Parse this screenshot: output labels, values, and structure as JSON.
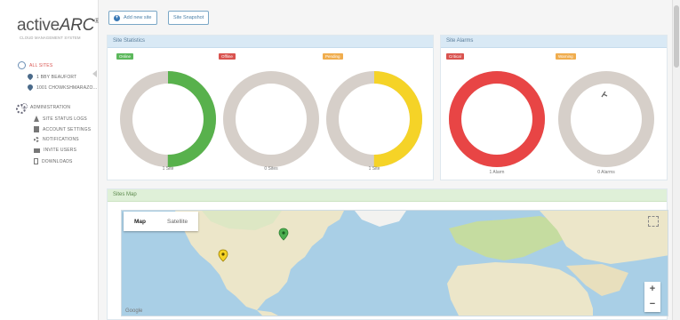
{
  "logo": {
    "text_a": "active",
    "text_b": "ARC",
    "mark": "®",
    "subtitle": "CLOUD MANAGEMENT SYSTEM"
  },
  "sidebar": {
    "items": [
      {
        "label": "ALL SITES",
        "icon": "globe-icon",
        "active": true
      },
      {
        "label": "1 BBY BEAUFORT",
        "icon": "map-pin-icon"
      },
      {
        "label": "1001 CHOWKSHMARAZO...",
        "icon": "map-pin-icon"
      }
    ],
    "admin": {
      "label": "ADMINISTRATION",
      "icon": "gears-icon",
      "items": [
        {
          "label": "SITE STATUS LOGS",
          "icon": "cone-icon"
        },
        {
          "label": "ACCOUNT SETTINGS",
          "icon": "document-icon"
        },
        {
          "label": "NOTIFICATIONS",
          "icon": "gear-icon"
        },
        {
          "label": "INVITE USERS",
          "icon": "mail-icon"
        },
        {
          "label": "DOWNLOADS",
          "icon": "file-icon"
        }
      ]
    }
  },
  "toolbar": {
    "add_site_label": "Add new site",
    "snapshot_label": "Site Snapshot"
  },
  "site_statistics": {
    "title": "Site Statistics",
    "donuts": [
      {
        "badge": "Online",
        "badge_color": "#5cb85c",
        "ring_color": "#58b14c",
        "fraction": 0.5,
        "caption": "1 Site"
      },
      {
        "badge": "Offline",
        "badge_color": "#d9534f",
        "ring_color": "#d9534f",
        "fraction": 0,
        "caption": "0 Sites"
      },
      {
        "badge": "Pending",
        "badge_color": "#f0ad4e",
        "ring_color": "#f5d327",
        "fraction": 0.5,
        "caption": "1 Site"
      }
    ]
  },
  "site_alarms": {
    "title": "Site Alarms",
    "donuts": [
      {
        "badge": "Critical",
        "badge_color": "#d9534f",
        "ring_color": "#e84545",
        "fraction": 1,
        "caption": "1 Alarm"
      },
      {
        "badge": "Warning",
        "badge_color": "#f0ad4e",
        "ring_color": "#f0ad4e",
        "fraction": 0,
        "caption": "0 Alarms"
      }
    ]
  },
  "map": {
    "title": "Sites Map",
    "tab_map": "Map",
    "tab_satellite": "Satellite",
    "zoom_in": "+",
    "zoom_out": "−",
    "attribution": "Google",
    "colors": {
      "water": "#a9cfe6",
      "land": "#ece6c9",
      "green_land": "#c5dca0"
    }
  }
}
